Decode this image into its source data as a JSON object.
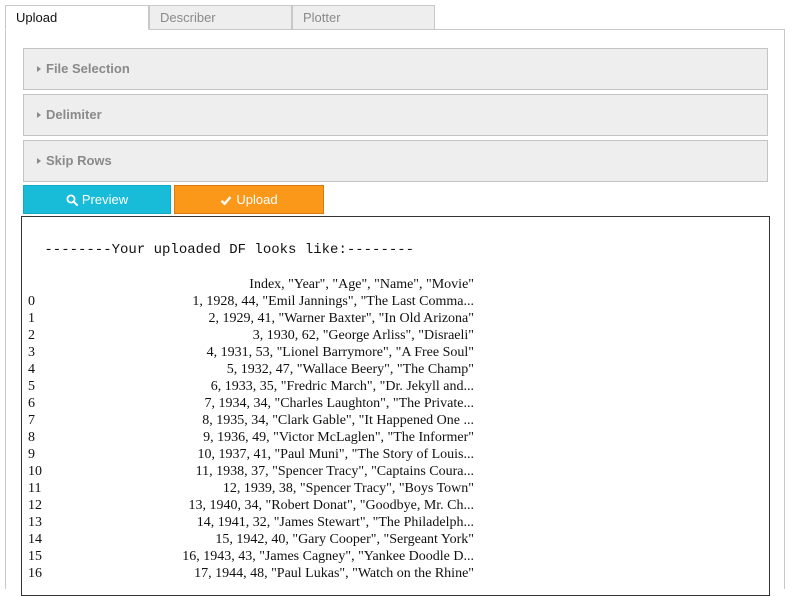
{
  "tabs": [
    {
      "label": "Upload",
      "active": true
    },
    {
      "label": "Describer",
      "active": false
    },
    {
      "label": "Plotter",
      "active": false
    }
  ],
  "sections": [
    {
      "label": "File Selection",
      "icon": "caret-right-icon"
    },
    {
      "label": "Delimiter",
      "icon": "caret-right-icon"
    },
    {
      "label": "Skip Rows",
      "icon": "caret-right-icon"
    }
  ],
  "buttons": {
    "preview_label": "Preview",
    "preview_icon": "search-icon",
    "preview_color": "#18bcd8",
    "upload_label": "Upload",
    "upload_icon": "check-icon",
    "upload_color": "#fb9719"
  },
  "output": {
    "title": " --------Your uploaded DF looks like:--------",
    "header": "Index, \"Year\", \"Age\", \"Name\", \"Movie\"",
    "rows": [
      {
        "index": "0",
        "value": "1, 1928, 44, \"Emil Jannings\", \"The Last Comma..."
      },
      {
        "index": "1",
        "value": "2, 1929, 41, \"Warner Baxter\", \"In Old Arizona\""
      },
      {
        "index": "2",
        "value": "3, 1930, 62, \"George Arliss\", \"Disraeli\""
      },
      {
        "index": "3",
        "value": "4, 1931, 53, \"Lionel Barrymore\", \"A Free Soul\""
      },
      {
        "index": "4",
        "value": "5, 1932, 47, \"Wallace Beery\", \"The Champ\""
      },
      {
        "index": "5",
        "value": "6, 1933, 35, \"Fredric March\", \"Dr. Jekyll and..."
      },
      {
        "index": "6",
        "value": "7, 1934, 34, \"Charles Laughton\", \"The Private..."
      },
      {
        "index": "7",
        "value": "8, 1935, 34, \"Clark Gable\", \"It Happened One ..."
      },
      {
        "index": "8",
        "value": "9, 1936, 49, \"Victor McLaglen\", \"The Informer\""
      },
      {
        "index": "9",
        "value": "10, 1937, 41, \"Paul Muni\", \"The Story of Louis..."
      },
      {
        "index": "10",
        "value": "11, 1938, 37, \"Spencer Tracy\", \"Captains Coura..."
      },
      {
        "index": "11",
        "value": "12, 1939, 38, \"Spencer Tracy\", \"Boys Town\""
      },
      {
        "index": "12",
        "value": "13, 1940, 34, \"Robert Donat\", \"Goodbye, Mr. Ch..."
      },
      {
        "index": "13",
        "value": "14, 1941, 32, \"James Stewart\", \"The Philadelph..."
      },
      {
        "index": "14",
        "value": "15, 1942, 40, \"Gary Cooper\", \"Sergeant York\""
      },
      {
        "index": "15",
        "value": "16, 1943, 43, \"James Cagney\", \"Yankee Doodle D..."
      },
      {
        "index": "16",
        "value": "17, 1944, 48, \"Paul Lukas\", \"Watch on the Rhine\""
      }
    ]
  }
}
